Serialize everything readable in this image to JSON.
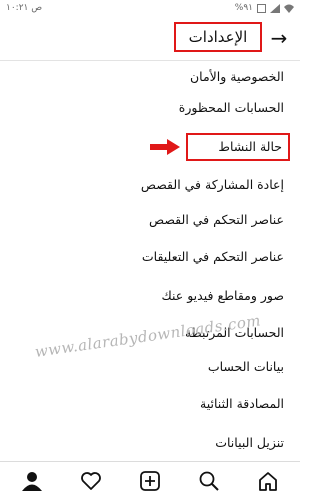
{
  "statusbar": {
    "time": "ص ١٠:٢١",
    "battery": "%٩١"
  },
  "header": {
    "title": "الإعدادات"
  },
  "menu": {
    "items": [
      "الخصوصية والأمان",
      "الحسابات المحظورة",
      "حالة النشاط",
      "إعادة المشاركة في القصص",
      "عناصر التحكم في القصص",
      "عناصر التحكم في التعليقات",
      "صور ومقاطع فيديو عنك",
      "الحسابات المرتبطة",
      "بيانات الحساب",
      "المصادقة الثنائية",
      "تنزيل البيانات"
    ]
  },
  "watermark": "www.alarabydownloads.com",
  "colors": {
    "highlight": "#e01818",
    "text": "#111111"
  },
  "bottom_nav": {
    "icons": [
      "profile-icon",
      "heart-icon",
      "add-post-icon",
      "search-icon",
      "home-icon"
    ]
  }
}
